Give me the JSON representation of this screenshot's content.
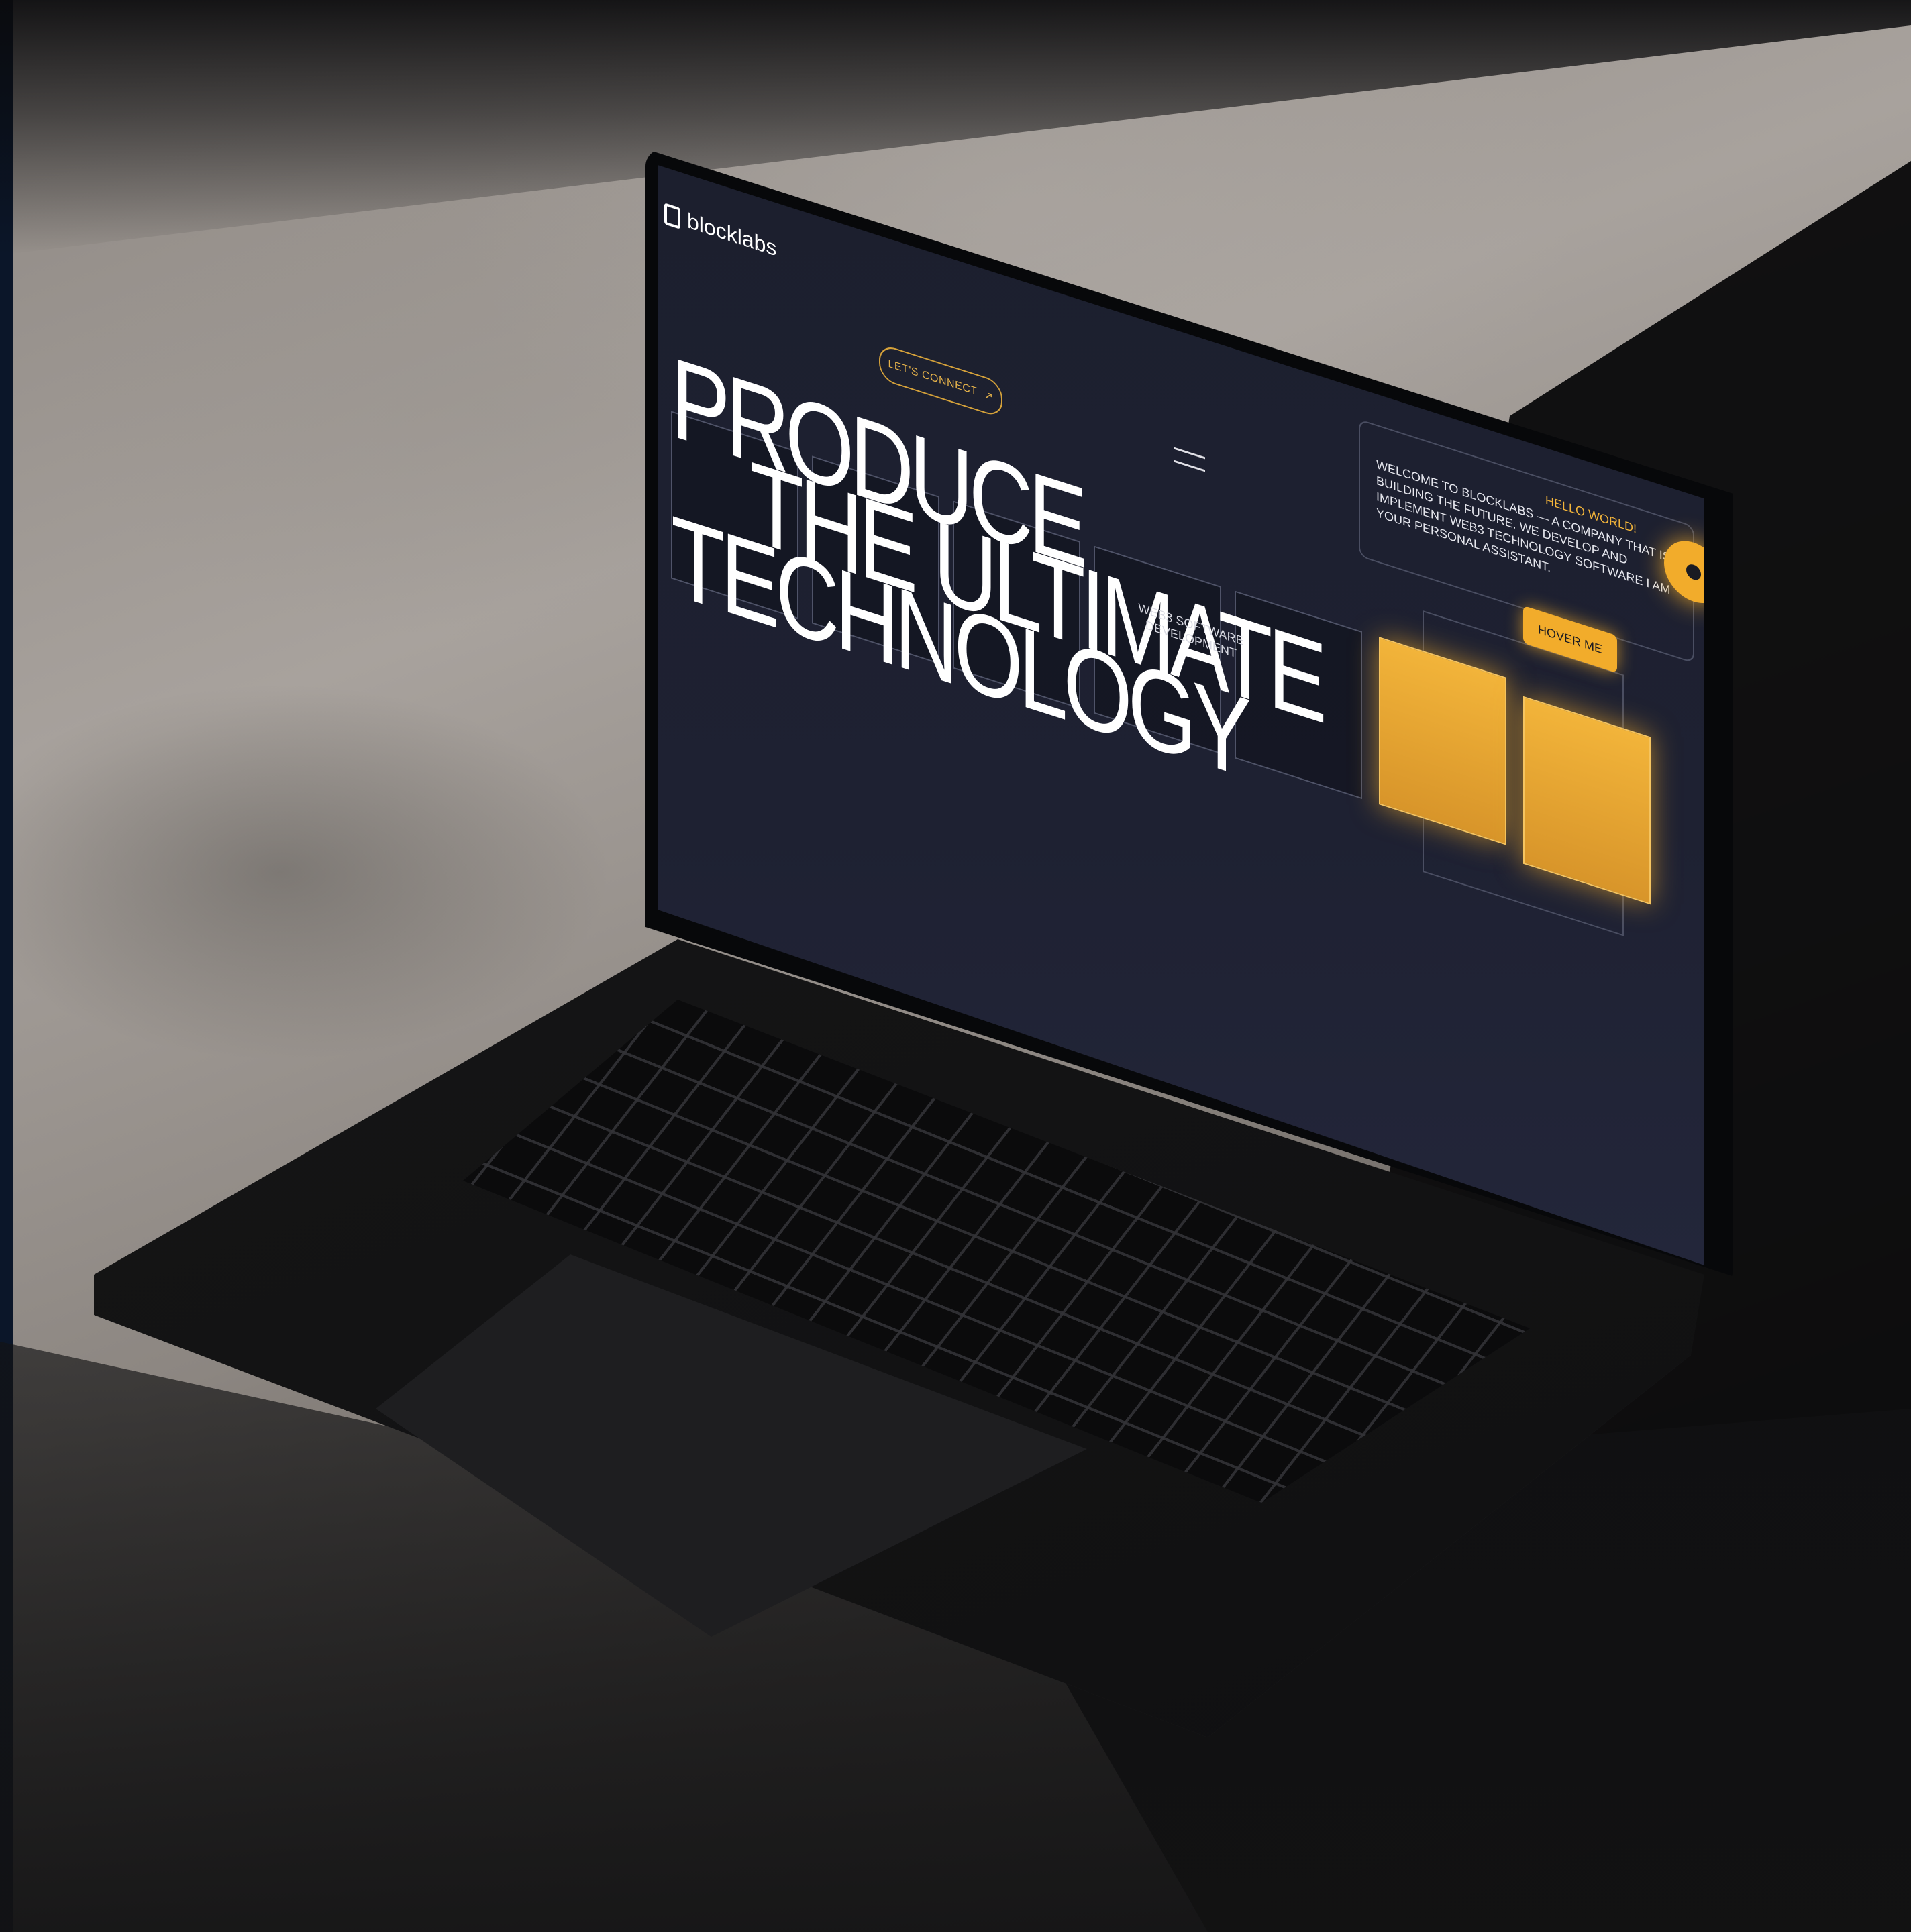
{
  "site": {
    "brand": "blocklabs",
    "connect_label": "LET'S CONNECT",
    "connect_arrow": "↗",
    "headline": [
      "PRODUCE",
      "THE ULTIMATE",
      "TECHNOLOGY"
    ],
    "subtext": "WEB3 SOFTWARE DEVELOPMENT",
    "card": {
      "title": "HELLO WORLD!",
      "body": "WELCOME TO BLOCKLABS — A COMPANY THAT IS BUILDING THE FUTURE. WE DEVELOP AND IMPLEMENT WEB3 TECHNOLOGY SOFTWARE I AM YOUR PERSONAL ASSISTANT."
    },
    "hover_label": "HOVER ME"
  },
  "colors": {
    "accent": "#f2ac2b",
    "screen_bg": "#1e2132",
    "stone": "#a8a29d",
    "laptop": "#141415"
  },
  "icons": {
    "menu": "hamburger-icon",
    "logo": "blocklabs-logo-icon",
    "assistant": "assistant-avatar-icon"
  }
}
